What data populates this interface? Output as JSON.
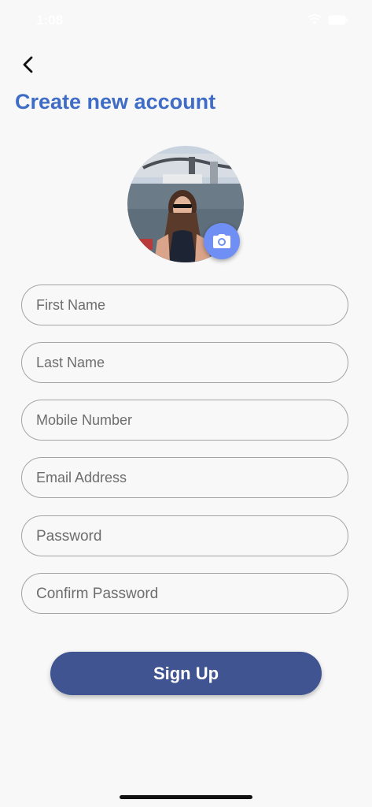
{
  "status_bar": {
    "time": "1:08"
  },
  "header": {
    "title": "Create new account"
  },
  "form": {
    "first_name_placeholder": "First Name",
    "last_name_placeholder": "Last Name",
    "mobile_placeholder": "Mobile Number",
    "email_placeholder": "Email Address",
    "password_placeholder": "Password",
    "confirm_password_placeholder": "Confirm Password"
  },
  "actions": {
    "signup_label": "Sign Up"
  },
  "colors": {
    "title": "#3f6cc6",
    "camera_button": "#6f8ff5",
    "signup_button": "#405491",
    "background": "#f8f8f8"
  }
}
